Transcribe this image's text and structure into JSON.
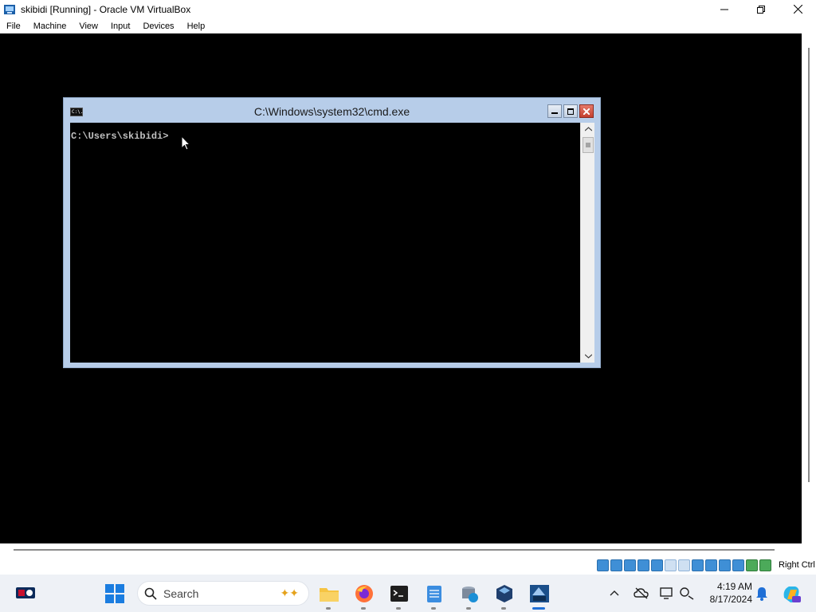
{
  "host_window": {
    "title": "skibidi [Running] - Oracle VM VirtualBox",
    "controls": [
      "minimize",
      "maximize",
      "close"
    ]
  },
  "menu": {
    "items": [
      "File",
      "Machine",
      "View",
      "Input",
      "Devices",
      "Help"
    ]
  },
  "cmd_window": {
    "title": "C:\\Windows\\system32\\cmd.exe",
    "icon_text": "C:\\.",
    "prompt": "C:\\Users\\skibidi>"
  },
  "status_bar": {
    "host_key": "Right Ctrl",
    "icons": [
      "hard-disk-icon",
      "optical-drive-icon",
      "floppy-icon",
      "audio-icon",
      "network-icon",
      "usb-icon",
      "shared-folders-icon",
      "display-icon",
      "recording-icon",
      "vt-x-icon",
      "guest-additions-icon",
      "mouse-integration-icon",
      "keyboard-icon"
    ]
  },
  "taskbar": {
    "search_placeholder": "Search",
    "apps": [
      "file-explorer-icon",
      "firefox-icon",
      "terminal-icon",
      "notepad-icon",
      "network-drive-icon",
      "virtualbox-icon",
      "server-2012-vm-icon"
    ],
    "active_app": "server-2012-vm-icon",
    "time": "4:19 AM",
    "date": "8/17/2024"
  },
  "colors": {
    "cmd_frame": "#b7cde9",
    "taskbar": "#eef1f6",
    "accent": "#1f6fd6"
  }
}
